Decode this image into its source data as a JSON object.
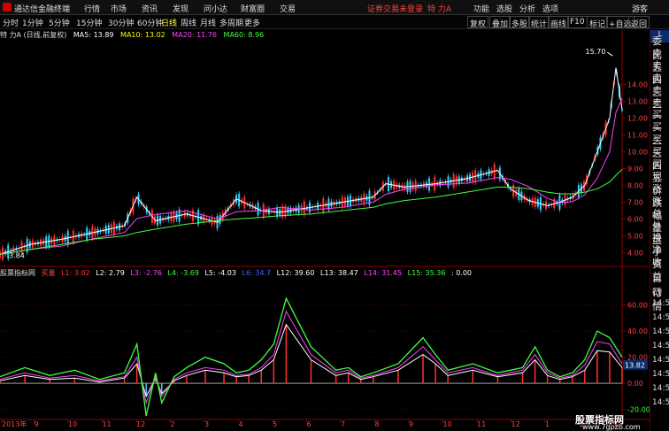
{
  "app": {
    "brand": "通达信金融终端",
    "menus": [
      "行情",
      "市场",
      "资讯",
      "发现",
      "问小达",
      "财富圈",
      "交易"
    ],
    "warning": "证券交易未登录",
    "stock_short": "特 力A",
    "right_menus": [
      "功能",
      "选股",
      "分析",
      "选项"
    ],
    "guest": "游客"
  },
  "periods": [
    "分时",
    "1分钟",
    "5分钟",
    "15分钟",
    "30分钟",
    "60分钟",
    "日线",
    "周线",
    "月线",
    "多周期",
    "更多"
  ],
  "selected_period": "日线",
  "toolbar_buttons": [
    "复权",
    "叠加",
    "多股",
    "统计",
    "画线",
    "F10",
    "标记",
    "+自选",
    "返回"
  ],
  "main_title": "特 力A (日线,前复权)",
  "ma": [
    {
      "label": "MA5: 13.89",
      "color": "#ffffff"
    },
    {
      "label": "MA10: 13.02",
      "color": "#ffff00"
    },
    {
      "label": "MA20: 11.76",
      "color": "#ff40ff"
    },
    {
      "label": "MA60: 8.96",
      "color": "#40ff40"
    }
  ],
  "ind_title": "股票指标网",
  "ind_label": "买量",
  "ind_values": [
    {
      "label": "L1: 3.02",
      "color": "#ff3030"
    },
    {
      "label": "L2: 2.79",
      "color": "#ffffff"
    },
    {
      "label": "L3: -2.76",
      "color": "#ff40ff"
    },
    {
      "label": "L4: -3.69",
      "color": "#40ff40"
    },
    {
      "label": "L5: -4.03",
      "color": "#ffffff"
    },
    {
      "label": "L6: 34.7",
      "color": "#4060ff"
    },
    {
      "label": "L12: 39.60",
      "color": "#ffffff"
    },
    {
      "label": "L13: 38.47",
      "color": "#ffffff"
    },
    {
      "label": "L14: 31.45",
      "color": "#ff40ff"
    },
    {
      "label": "L15: 35.36",
      "color": "#40ff40"
    },
    {
      "label": ": 0.00",
      "color": "#ffffff"
    }
  ],
  "price_axis": [
    "14.00",
    "13.00",
    "12.00",
    "11.00",
    "10.00",
    "9.00",
    "8.00",
    "7.00",
    "6.00",
    "5.00",
    "4.00"
  ],
  "high_label": "15.70",
  "low_label": "3.84",
  "ind_axis": [
    "60.00",
    "40.00",
    "20.00",
    "0.00",
    "-20.00"
  ],
  "ind_current": "13.82",
  "date_labels": [
    "2013年",
    "9",
    "10",
    "11",
    "12",
    "2",
    "3",
    "4",
    "5",
    "6",
    "7",
    "8",
    "9",
    "10",
    "11",
    "12",
    "1",
    "2",
    "3"
  ],
  "right_panel": [
    "委比",
    "卖五",
    "卖四",
    "卖三",
    "卖二",
    "卖一",
    "买一",
    "买二",
    "买三",
    "买四",
    "买五",
    "现价",
    "涨跌",
    "涨幅",
    "总量",
    "外盘",
    "换手",
    "净资",
    "收益"
  ],
  "right_tag": "L",
  "right_panel2": [
    "自动",
    "行情",
    "14:50",
    "14:50",
    "14:50",
    "14:50",
    "14:50",
    "14:50",
    "14:50",
    "14:50"
  ],
  "watermark": {
    "title": "股票指标网",
    "url": "www.7gpzb.com"
  },
  "chart_data": {
    "type": "line",
    "price_range": [
      3.5,
      16.5
    ],
    "price_x": [
      0,
      0.05,
      0.1,
      0.15,
      0.2,
      0.22,
      0.25,
      0.3,
      0.35,
      0.38,
      0.42,
      0.45,
      0.5,
      0.55,
      0.6,
      0.62,
      0.65,
      0.7,
      0.75,
      0.8,
      0.82,
      0.85,
      0.88,
      0.9,
      0.92,
      0.94,
      0.96,
      0.98,
      0.99,
      1.0
    ],
    "close": [
      3.9,
      4.5,
      4.8,
      5.2,
      5.6,
      7.3,
      5.9,
      6.3,
      5.8,
      7.2,
      6.5,
      6.4,
      6.7,
      7.0,
      7.3,
      8.1,
      7.9,
      8.1,
      8.4,
      8.9,
      7.8,
      7.1,
      6.8,
      7.0,
      7.3,
      8.0,
      10.0,
      12.0,
      15.0,
      12.5
    ],
    "ma60": [
      3.9,
      4.2,
      4.5,
      4.8,
      5.0,
      5.2,
      5.4,
      5.7,
      5.9,
      6.0,
      6.1,
      6.2,
      6.3,
      6.5,
      6.7,
      6.9,
      7.1,
      7.3,
      7.6,
      7.9,
      7.9,
      7.8,
      7.6,
      7.5,
      7.5,
      7.6,
      7.8,
      8.2,
      8.6,
      8.96
    ],
    "ind_range": [
      -25,
      78
    ],
    "ind_x": [
      0,
      0.04,
      0.08,
      0.12,
      0.16,
      0.2,
      0.22,
      0.235,
      0.25,
      0.26,
      0.28,
      0.3,
      0.33,
      0.36,
      0.38,
      0.4,
      0.42,
      0.44,
      0.46,
      0.5,
      0.54,
      0.56,
      0.58,
      0.6,
      0.64,
      0.68,
      0.7,
      0.72,
      0.76,
      0.8,
      0.84,
      0.86,
      0.88,
      0.9,
      0.92,
      0.94,
      0.96,
      0.98,
      1.0
    ],
    "L15": [
      5,
      12,
      6,
      10,
      3,
      8,
      30,
      -25,
      8,
      -15,
      5,
      12,
      20,
      15,
      8,
      10,
      18,
      30,
      65,
      28,
      10,
      12,
      5,
      8,
      15,
      35,
      22,
      10,
      15,
      8,
      12,
      28,
      10,
      5,
      8,
      18,
      40,
      35,
      20
    ],
    "L14": [
      3,
      8,
      4,
      6,
      2,
      5,
      20,
      -15,
      5,
      -10,
      3,
      8,
      12,
      10,
      6,
      7,
      12,
      22,
      55,
      22,
      8,
      10,
      4,
      6,
      12,
      28,
      18,
      8,
      12,
      6,
      10,
      22,
      8,
      4,
      6,
      14,
      32,
      30,
      15
    ],
    "L12": [
      2,
      6,
      3,
      4,
      1,
      4,
      15,
      -10,
      4,
      -8,
      2,
      6,
      10,
      8,
      5,
      6,
      10,
      18,
      45,
      18,
      6,
      8,
      3,
      5,
      10,
      22,
      15,
      6,
      10,
      5,
      8,
      18,
      6,
      3,
      5,
      10,
      25,
      24,
      12
    ]
  }
}
